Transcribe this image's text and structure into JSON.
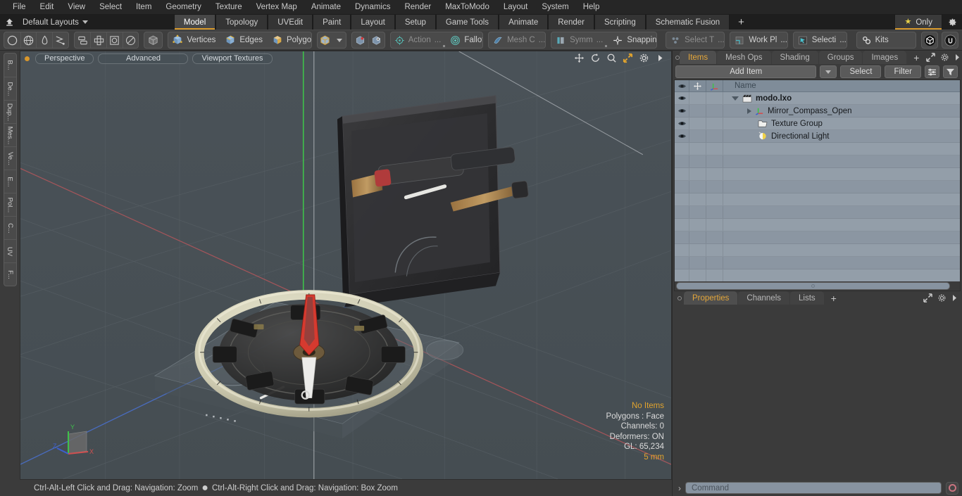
{
  "app": {
    "title": "modo",
    "accent": "#d99a2b",
    "panel_bg": "#3b3b3b",
    "list_bg": "#8e99a5"
  },
  "menubar": {
    "items": [
      "File",
      "Edit",
      "View",
      "Select",
      "Item",
      "Geometry",
      "Texture",
      "Vertex Map",
      "Animate",
      "Dynamics",
      "Render",
      "MaxToModo",
      "Layout",
      "System",
      "Help"
    ]
  },
  "layoutbar": {
    "home_icon": "home-icon",
    "layouts_label": "Default Layouts",
    "tabs": [
      {
        "label": "Model",
        "active": true
      },
      {
        "label": "Topology",
        "active": false
      },
      {
        "label": "UVEdit",
        "active": false
      },
      {
        "label": "Paint",
        "active": false
      },
      {
        "label": "Layout",
        "active": false
      },
      {
        "label": "Setup",
        "active": false
      },
      {
        "label": "Game Tools",
        "active": false
      },
      {
        "label": "Animate",
        "active": false
      },
      {
        "label": "Render",
        "active": false
      },
      {
        "label": "Scripting",
        "active": false
      },
      {
        "label": "Schematic Fusion",
        "active": false
      }
    ],
    "add_tab_label": "+",
    "only_label": "Only",
    "only_icon": "star-icon",
    "settings_icon": "gear-icon"
  },
  "toolbar": {
    "primitives": [
      {
        "icon": "circle-icon",
        "name": "primitive-circle"
      },
      {
        "icon": "globe-icon",
        "name": "primitive-sphere"
      },
      {
        "icon": "pen-icon",
        "name": "primitive-pen"
      },
      {
        "icon": "curve-icon",
        "name": "primitive-curve"
      }
    ],
    "transforms": [
      {
        "icon": "mirror-icon",
        "name": "mirror-tool"
      },
      {
        "icon": "array-icon",
        "name": "array-tool"
      },
      {
        "icon": "bevel-icon",
        "name": "bevel-tool"
      },
      {
        "icon": "radial-icon",
        "name": "radial-tool"
      }
    ],
    "item_mode": {
      "icon": "cube-icon",
      "name": "item-mode"
    },
    "selection_modes": [
      {
        "label": "Vertices",
        "icon": "cube-vertices-icon"
      },
      {
        "label": "Edges",
        "icon": "cube-edges-icon"
      },
      {
        "label": "Polygons",
        "icon": "cube-polygons-icon"
      }
    ],
    "cube_dropdown": {
      "icon": "cube-icon",
      "arrow": "chevron-down-icon"
    },
    "snap_icons": [
      {
        "icon": "snap-vertex-icon",
        "name": "snap-vertex-button"
      },
      {
        "icon": "snap-edge-icon",
        "name": "snap-edge-button"
      }
    ],
    "tools": [
      {
        "label": "Action",
        "suffix": "...",
        "icon": "action-center-icon",
        "dim": true
      },
      {
        "label": "Falloff",
        "suffix": "",
        "icon": "falloff-icon",
        "dim": false
      },
      {
        "label": "Mesh C",
        "suffix": "...",
        "icon": "mesh-constraint-icon",
        "dim": true
      },
      {
        "label": "Symm",
        "suffix": "...",
        "icon": "symmetry-icon",
        "dim": true
      },
      {
        "label": "Snapping",
        "suffix": "",
        "icon": "snapping-icon",
        "dim": false
      }
    ],
    "right_tools": [
      {
        "label": "Select T",
        "suffix": "...",
        "icon": "select-through-icon",
        "dim": true
      },
      {
        "label": "Work Pl",
        "suffix": "...",
        "icon": "work-plane-icon",
        "dim": false
      },
      {
        "label": "Selecti",
        "suffix": "...",
        "icon": "selection-set-icon",
        "dim": false
      }
    ],
    "kits": {
      "label": "Kits",
      "icon": "gears-icon"
    },
    "app_icons": [
      {
        "icon": "modo-icon",
        "name": "modo-logo-button"
      },
      {
        "icon": "unreal-icon",
        "name": "unreal-logo-button"
      }
    ]
  },
  "leftstrip": {
    "tabs": [
      "B...",
      "De...",
      "Dup...",
      "Mes...",
      "Ve...",
      "E...",
      "Pol...",
      "C...",
      "UV",
      "F..."
    ]
  },
  "viewport": {
    "header": {
      "indicator": "active-dot",
      "view_mode": "Perspective",
      "shading_mode": "Advanced",
      "texture_mode": "Viewport Textures"
    },
    "nav_icons": [
      {
        "icon": "pan-icon",
        "name": "viewport-pan-button",
        "active": false
      },
      {
        "icon": "rotate-icon",
        "name": "viewport-rotate-button",
        "active": false
      },
      {
        "icon": "zoom-icon",
        "name": "viewport-zoom-button",
        "active": false
      },
      {
        "icon": "fit-icon",
        "name": "viewport-fit-button",
        "active": true
      },
      {
        "icon": "gear-icon",
        "name": "viewport-settings-button",
        "active": false
      },
      {
        "icon": "chevron-right-icon",
        "name": "viewport-more-button",
        "active": false
      }
    ],
    "stats": {
      "selection": "No Items",
      "polygons": "Polygons : Face",
      "channels": "Channels: 0",
      "deformers": "Deformers: ON",
      "gl": "GL: 65,234",
      "grid_unit": "5 mm"
    },
    "gizmo": {
      "x_label": "X",
      "y_label": "Y",
      "z_label": "Z"
    },
    "scene_description": "3D model of an open mirror compass on a grid"
  },
  "statusbar": {
    "hint_left": "Ctrl-Alt-Left Click and Drag: Navigation: Zoom",
    "separator": "●",
    "hint_right": "Ctrl-Alt-Right Click and Drag: Navigation: Box Zoom"
  },
  "rightpanel": {
    "tabs": [
      {
        "label": "Items",
        "active": true
      },
      {
        "label": "Mesh Ops",
        "active": false
      },
      {
        "label": "Shading",
        "active": false
      },
      {
        "label": "Groups",
        "active": false
      },
      {
        "label": "Images",
        "active": false
      }
    ],
    "add_tab_label": "+",
    "header_icons": [
      {
        "icon": "expand-icon",
        "name": "panel-expand-button"
      },
      {
        "icon": "gear-icon",
        "name": "panel-settings-button"
      },
      {
        "icon": "chevron-right-icon",
        "name": "panel-more-button"
      }
    ],
    "toolrow": {
      "add_item_label": "Add Item",
      "add_item_arrow": "chevron-down-icon",
      "select_label": "Select",
      "filter_label": "Filter",
      "list_icon": "list-options-icon",
      "funnel_icon": "funnel-icon"
    },
    "list": {
      "columns": {
        "eye": "eye-icon",
        "lock": "move-icon",
        "axis": "axis-icon",
        "name": "Name"
      },
      "rows": [
        {
          "name": "modo.lxo",
          "icon": "scene-icon",
          "level": 0,
          "expander": "down",
          "eye": true
        },
        {
          "name": "Mirror_Compass_Open",
          "icon": "mesh-icon",
          "level": 1,
          "expander": "right",
          "eye": true
        },
        {
          "name": "Texture Group",
          "icon": "folder-icon",
          "level": 1,
          "expander": "none",
          "eye": true
        },
        {
          "name": "Directional Light",
          "icon": "light-icon",
          "level": 1,
          "expander": "none",
          "eye": true
        }
      ]
    },
    "props_tabs": [
      {
        "label": "Properties",
        "active": true
      },
      {
        "label": "Channels",
        "active": false
      },
      {
        "label": "Lists",
        "active": false
      }
    ],
    "props_add_label": "+"
  },
  "commandbar": {
    "chevron": "›",
    "placeholder": "Command",
    "value": "",
    "record_icon": "record-icon"
  }
}
